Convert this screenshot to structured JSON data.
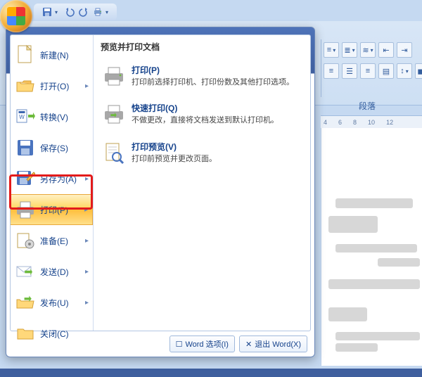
{
  "left_menu": {
    "new": "新建(N)",
    "open": "打开(O)",
    "convert": "转换(V)",
    "save": "保存(S)",
    "save_as": "另存为(A)",
    "print": "打印(P)",
    "prepare": "准备(E)",
    "send": "发送(D)",
    "publish": "发布(U)",
    "close": "关闭(C)"
  },
  "right_panel": {
    "header": "预览并打印文档",
    "items": [
      {
        "title": "打印(P)",
        "desc": "打印前选择打印机、打印份数及其他打印选项。"
      },
      {
        "title": "快速打印(Q)",
        "desc": "不做更改，直接将文档发送到默认打印机。"
      },
      {
        "title": "打印预览(V)",
        "desc": "打印前预览并更改页面。"
      }
    ]
  },
  "footer": {
    "options": "Word 选项(I)",
    "exit": "退出 Word(X)"
  },
  "ribbon": {
    "group": "段落"
  },
  "ruler_ticks": [
    "4",
    "6",
    "8",
    "10",
    "12"
  ]
}
